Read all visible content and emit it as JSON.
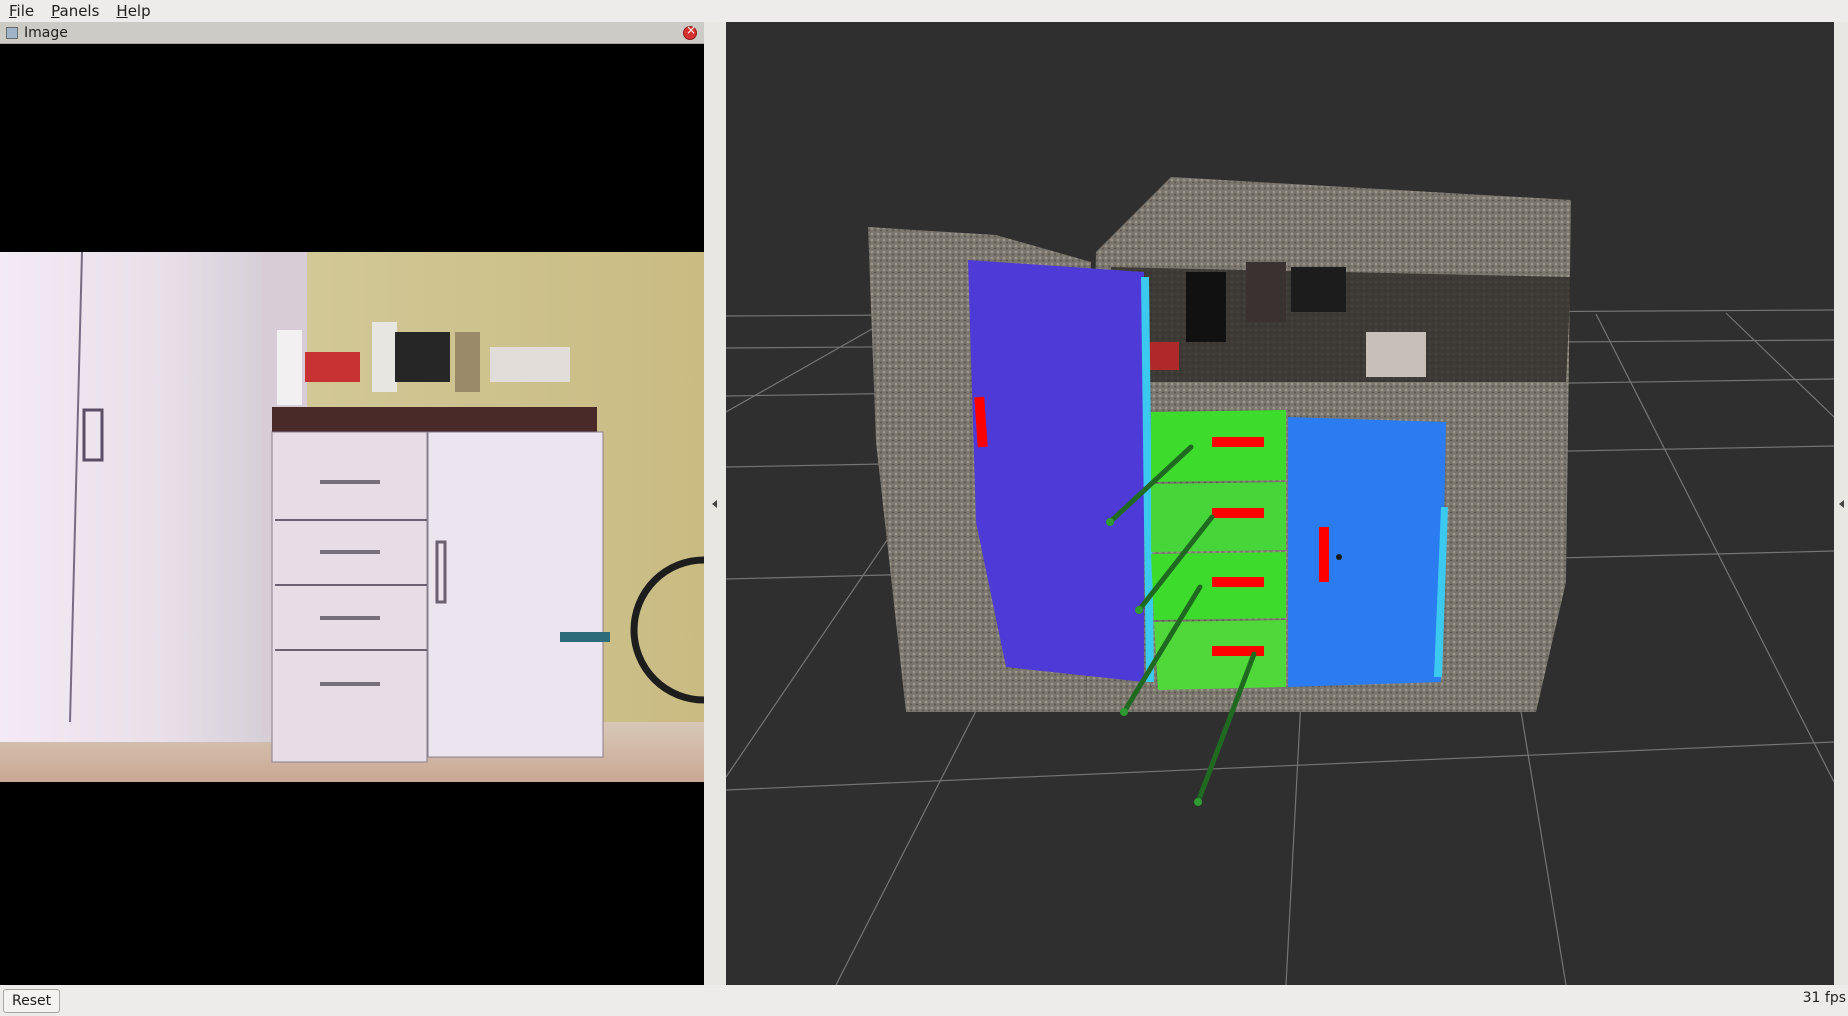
{
  "menu": [
    {
      "mnemonic": "F",
      "rest": "ile"
    },
    {
      "mnemonic": "P",
      "rest": "anels"
    },
    {
      "mnemonic": "H",
      "rest": "elp"
    }
  ],
  "image_panel": {
    "title": "Image"
  },
  "status": {
    "reset_label": "Reset",
    "fps": "31 fps"
  },
  "colors": {
    "accent_red": "#ff0000",
    "drawer_green": "#3ddc2c",
    "door_blue": "#2a7cf0",
    "door_purple": "#4e3ad6",
    "axis_green": "#1f6a20"
  },
  "icons": {
    "panel": "image-panel-icon",
    "close": "close-icon"
  }
}
